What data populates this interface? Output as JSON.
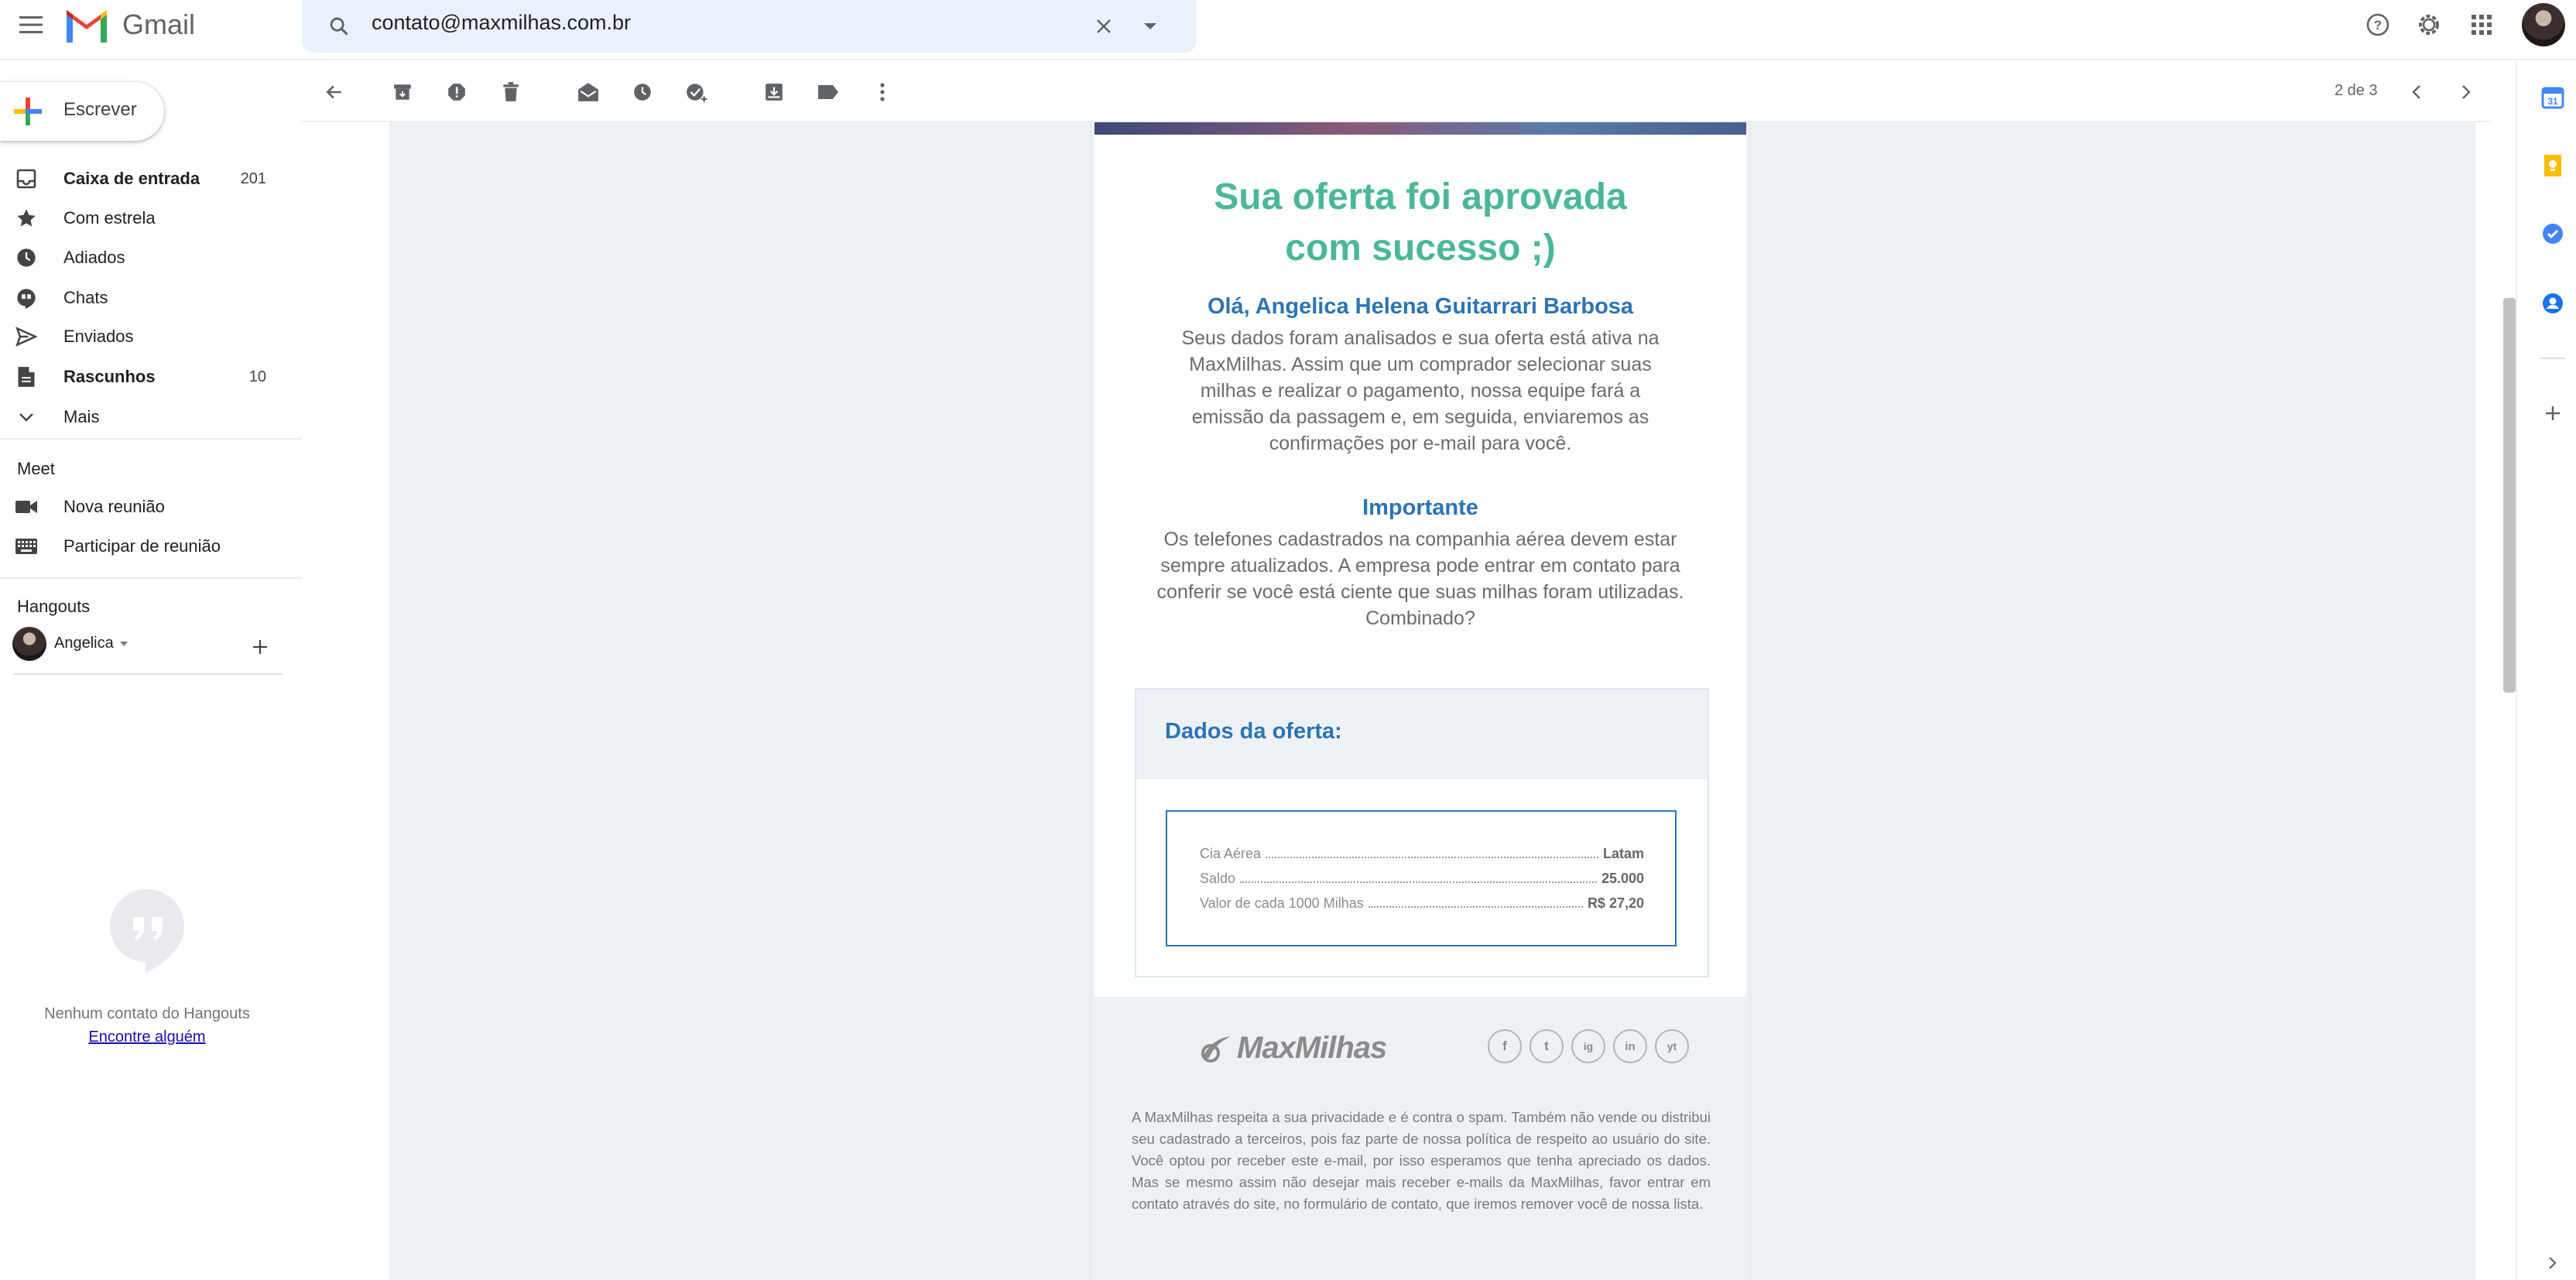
{
  "app": {
    "name": "Gmail"
  },
  "search": {
    "value": "contato@maxmilhas.com.br"
  },
  "compose": {
    "label": "Escrever"
  },
  "nav": {
    "items": [
      {
        "label": "Caixa de entrada",
        "count": "201",
        "bold": true
      },
      {
        "label": "Com estrela",
        "count": ""
      },
      {
        "label": "Adiados",
        "count": ""
      },
      {
        "label": "Chats",
        "count": ""
      },
      {
        "label": "Enviados",
        "count": ""
      },
      {
        "label": "Rascunhos",
        "count": "10",
        "bold": true
      },
      {
        "label": "Mais",
        "count": ""
      }
    ]
  },
  "meet": {
    "title": "Meet",
    "items": [
      {
        "label": "Nova reunião"
      },
      {
        "label": "Participar de reunião"
      }
    ]
  },
  "hangouts": {
    "title": "Hangouts",
    "user": "Angelica",
    "empty_text": "Nenhum contato do Hangouts",
    "find_link": "Encontre alguém"
  },
  "toolbar": {
    "pager": "2 de 3"
  },
  "email": {
    "headline_line1": "Sua oferta foi aprovada",
    "headline_line2": "com sucesso ;)",
    "greeting": "Olá, Angelica Helena Guitarrari Barbosa",
    "intro": "Seus dados foram analisados e sua oferta está ativa na MaxMilhas. Assim que um comprador selecionar suas milhas e realizar o pagamento, nossa equipe fará a emissão da passagem e, em seguida, enviaremos as confirmações por e-mail para você.",
    "important_title": "Importante",
    "important_text": "Os telefones cadastrados na companhia aérea devem estar sempre atualizados. A empresa pode entrar em contato para conferir se você está ciente que suas milhas foram utilizadas. Combinado?",
    "offer_title": "Dados da oferta:",
    "offer_rows": [
      {
        "label": "Cia Aérea",
        "value": "Latam"
      },
      {
        "label": "Saldo",
        "value": "25.000"
      },
      {
        "label": "Valor de cada 1000 Milhas",
        "value": "R$ 27,20"
      }
    ],
    "footer_logo": "MaxMilhas",
    "social": [
      "f",
      "t",
      "ig",
      "in",
      "yt"
    ],
    "footer_text": "A MaxMilhas respeita a sua privacidade e é contra o spam. Também não vende ou distribui seu cadastrado a terceiros, pois faz parte de nossa política de respeito ao usuário do site. Você optou por receber este e-mail, por isso esperamos que tenha apreciado os dados. Mas se mesmo assim não desejar mais receber e-mails da MaxMilhas, favor entrar em contato através do site, no formulário de contato, que iremos remover você de nossa lista."
  },
  "colors": {
    "headline": "#4bb79a",
    "heading_blue": "#2c74b3",
    "email_bg": "#edf1f5"
  }
}
